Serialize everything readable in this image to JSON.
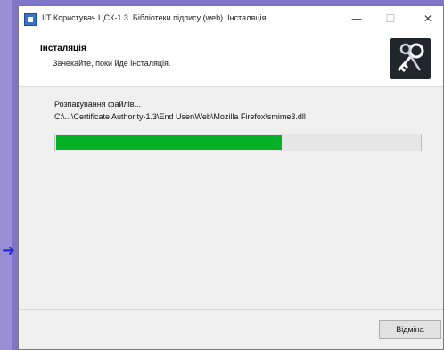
{
  "window": {
    "title": "IIT Користувач ЦСК-1.3. Бібліотеки підпису (web). Інсталяція",
    "minimize_glyph": "—",
    "maximize_glyph": "☐",
    "close_glyph": "✕"
  },
  "header": {
    "title": "Інсталяція",
    "subtitle": "Зачекайте, поки йде інсталяція."
  },
  "content": {
    "status": "Розпакування файлів...",
    "path": "C:\\...\\Certificate Authority-1.3\\End User\\Web\\Mozilla Firefox\\smime3.dll",
    "progress": 0.62,
    "progress_color": "#06b025"
  },
  "footer": {
    "cancel_label": "Відміна"
  },
  "icons": {
    "app": "app-icon",
    "logo": "keys-icon",
    "annotation": "arrow-right-icon"
  }
}
